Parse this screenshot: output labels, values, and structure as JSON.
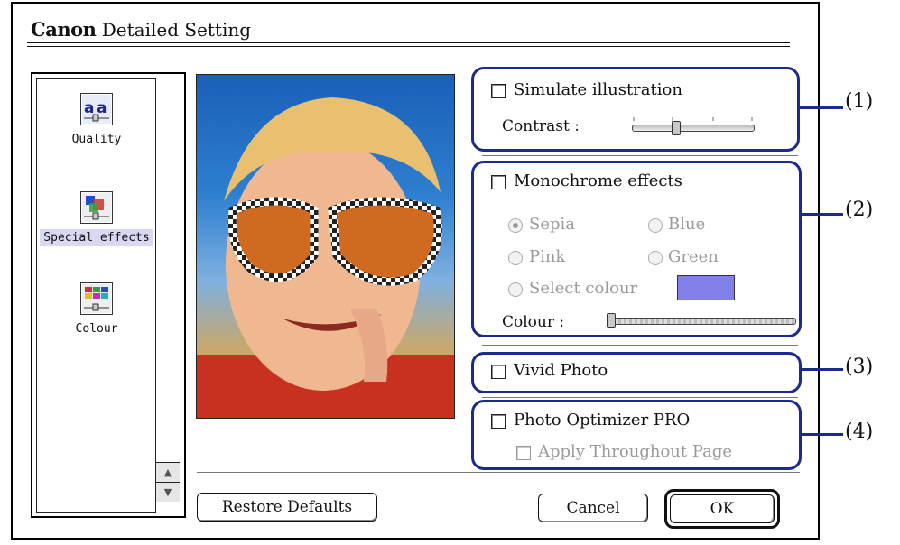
{
  "window": {
    "brand": "Canon",
    "title": "Detailed Setting"
  },
  "sidebar": {
    "items": [
      {
        "label": "Quality",
        "icon": "quality-icon",
        "selected": false
      },
      {
        "label": "Special effects",
        "icon": "special-effects-icon",
        "selected": true
      },
      {
        "label": "Colour",
        "icon": "colour-icon",
        "selected": false
      }
    ]
  },
  "groups": {
    "simulate": {
      "label": "Simulate illustration",
      "checked": false,
      "contrast_label": "Contrast :",
      "contrast_level": 0.35
    },
    "monochrome": {
      "label": "Monochrome effects",
      "checked": false,
      "options": {
        "sepia": "Sepia",
        "blue": "Blue",
        "pink": "Pink",
        "green": "Green",
        "select": "Select colour"
      },
      "selected_option": "Sepia",
      "swatch_color": "#8080e8",
      "colour_label": "Colour :",
      "colour_level": 0.0
    },
    "vivid": {
      "label": "Vivid Photo",
      "checked": false
    },
    "optimizer": {
      "label": "Photo Optimizer PRO",
      "checked": false,
      "sub_label": "Apply Throughout Page",
      "sub_checked": false
    }
  },
  "callouts": [
    "(1)",
    "(2)",
    "(3)",
    "(4)"
  ],
  "buttons": {
    "restore": "Restore Defaults",
    "cancel": "Cancel",
    "ok": "OK"
  },
  "colors": {
    "callout_blue": "#1b2a8e",
    "selected_item": "#d8d8f4"
  }
}
